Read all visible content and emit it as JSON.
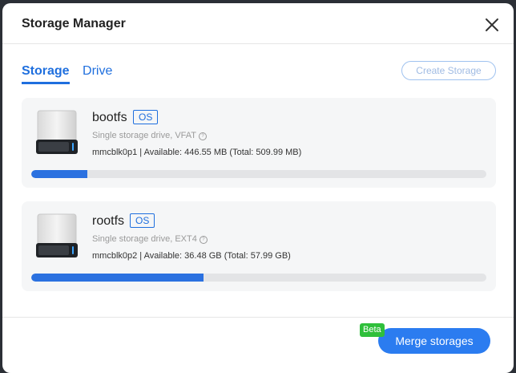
{
  "dialog": {
    "title": "Storage Manager"
  },
  "tabs": [
    {
      "label": "Storage",
      "active": true
    },
    {
      "label": "Drive",
      "active": false
    }
  ],
  "create_button": "Create Storage",
  "storages": [
    {
      "name": "bootfs",
      "badge": "OS",
      "fs_label": "Single storage drive, VFAT",
      "usage": "mmcblk0p1 | Available: 446.55 MB (Total: 509.99 MB)",
      "used_fraction": 0.124
    },
    {
      "name": "rootfs",
      "badge": "OS",
      "fs_label": "Single storage drive, EXT4",
      "usage": "mmcblk0p2 | Available: 36.48 GB (Total: 57.99 GB)",
      "used_fraction": 0.379
    }
  ],
  "merge_button": "Merge storages",
  "beta_badge": "Beta",
  "colors": {
    "accent": "#2b7cf0",
    "beta": "#2fbf3b"
  },
  "icons": {
    "close": "close-icon",
    "drive": "hard-drive-icon",
    "info": "info-icon"
  }
}
